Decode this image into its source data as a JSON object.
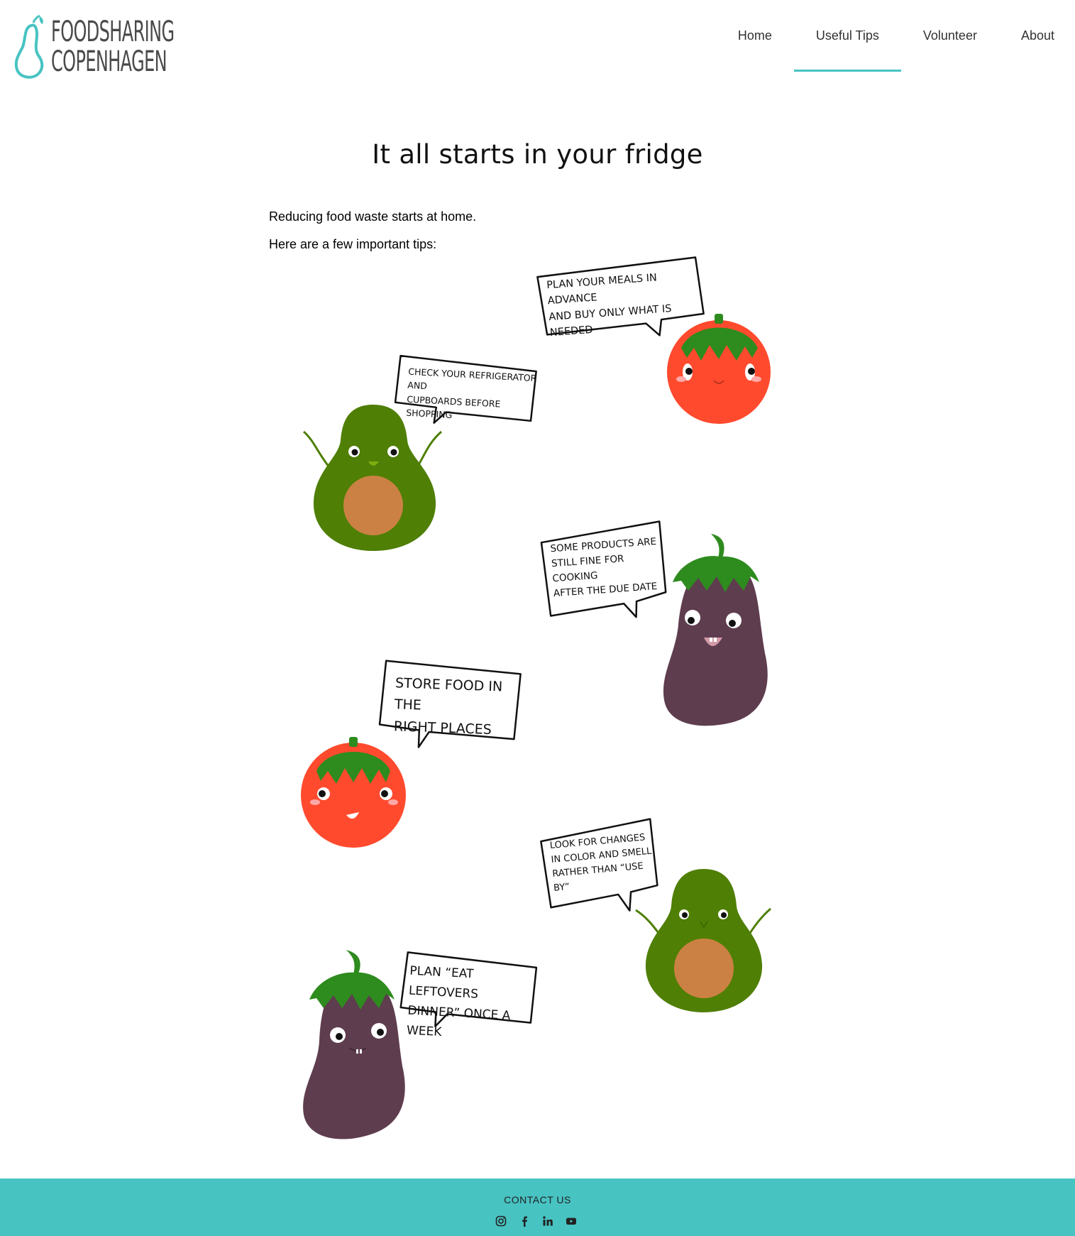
{
  "brand": {
    "line1": "FOODSHARING",
    "line2": "COPENHAGEN",
    "accent": "#47c3c2"
  },
  "nav": {
    "items": [
      {
        "label": "Home"
      },
      {
        "label": "Useful Tips"
      },
      {
        "label": "Volunteer"
      },
      {
        "label": "About"
      }
    ],
    "active": "Useful Tips"
  },
  "main": {
    "title": "It all starts in your fridge",
    "intro": [
      "Reducing food waste starts at home.",
      "Here are a few important tips:"
    ],
    "tips": [
      {
        "text": "Plan your meals in advance\nand buy only what is needed",
        "character": "tomato"
      },
      {
        "text": "Check your refrigerator and\ncupboards before shopping",
        "character": "avocado"
      },
      {
        "text": "Some products are\nstill fine for cooking\nafter the due date",
        "character": "eggplant"
      },
      {
        "text": "Store food in the\nright places",
        "character": "tomato"
      },
      {
        "text": "Look for changes\nin color and smell\nrather than “use by”",
        "character": "avocado"
      },
      {
        "text": "Plan “eat leftovers\ndinner” once a week",
        "character": "eggplant"
      }
    ]
  },
  "colors": {
    "tomato": "#ff4a2e",
    "leaf": "#2e8b1e",
    "avocado_skin": "#4f7f05",
    "avocado_pit": "#cc8144",
    "eggplant": "#5e3d4e"
  },
  "footer": {
    "title": "CONTACT US",
    "social": [
      {
        "icon": "instagram-icon"
      },
      {
        "icon": "facebook-icon"
      },
      {
        "icon": "linkedin-icon"
      },
      {
        "icon": "youtube-icon"
      }
    ]
  }
}
